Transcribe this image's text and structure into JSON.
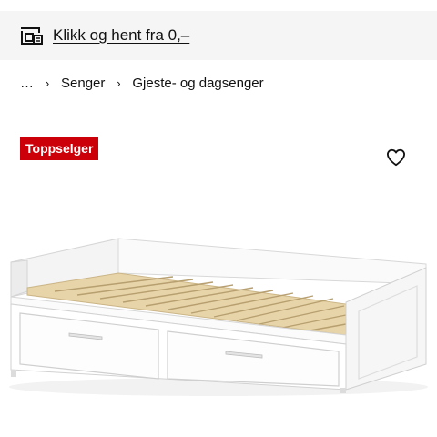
{
  "promo": {
    "text": "Klikk og hent fra 0,–",
    "icon": "click-and-collect-icon"
  },
  "breadcrumb": {
    "items": [
      "…",
      "Senger",
      "Gjeste- og dagsenger"
    ],
    "separator": "›"
  },
  "badge": {
    "label": "Toppselger",
    "color": "#cc0008"
  },
  "favorite": {
    "icon": "heart-icon"
  },
  "product": {
    "image": "white-daybed-with-two-drawers"
  },
  "colors": {
    "promo_background": "#f5f5f5",
    "badge_background": "#cc0008",
    "text": "#111111"
  }
}
